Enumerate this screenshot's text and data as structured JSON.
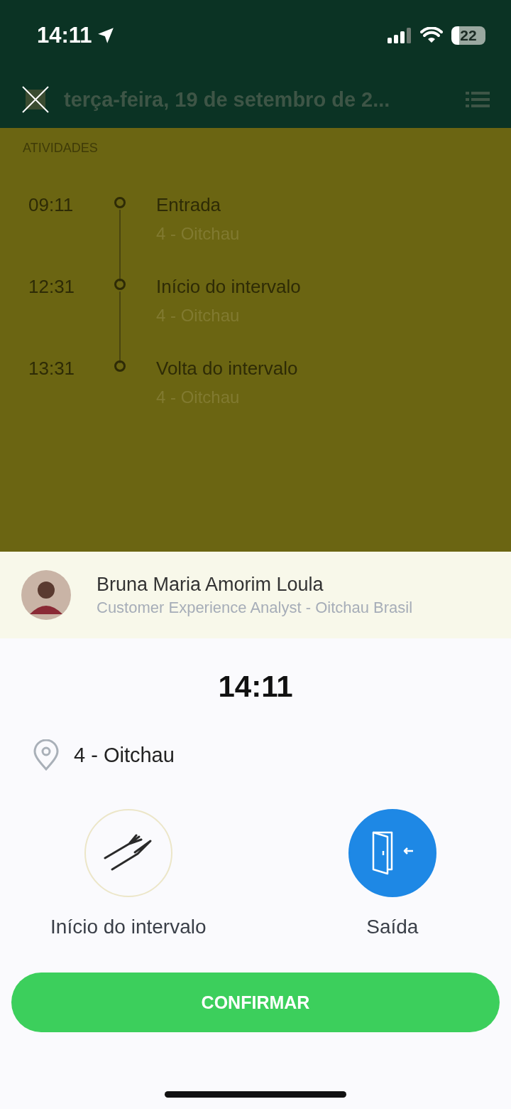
{
  "status_bar": {
    "time": "14:11",
    "battery": "22"
  },
  "header": {
    "title": "terça-feira, 19 de setembro de 2..."
  },
  "activities": {
    "heading": "ATIVIDADES",
    "items": [
      {
        "time": "09:11",
        "title": "Entrada",
        "place": "4 - Oitchau"
      },
      {
        "time": "12:31",
        "title": "Início do intervalo",
        "place": "4 - Oitchau"
      },
      {
        "time": "13:31",
        "title": "Volta do intervalo",
        "place": "4 - Oitchau"
      }
    ]
  },
  "profile": {
    "name": "Bruna Maria Amorim Loula",
    "role": "Customer Experience Analyst - Oitchau Brasil"
  },
  "clock": "14:11",
  "location": "4 - Oitchau",
  "options": [
    {
      "kind": "break",
      "label": "Início do intervalo",
      "selected": false
    },
    {
      "kind": "exit",
      "label": "Saída",
      "selected": true
    }
  ],
  "confirm_button": "CONFIRMAR"
}
